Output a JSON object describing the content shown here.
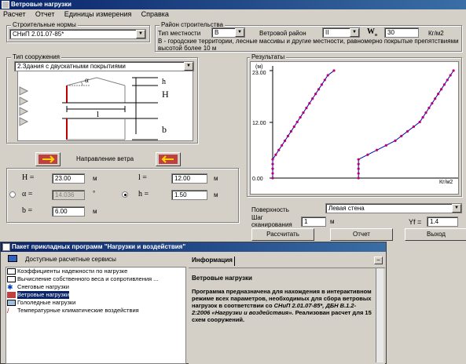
{
  "window1": {
    "title": "Ветровые нагрузки",
    "menu": [
      "Расчет",
      "Отчет",
      "Единицы измерения",
      "Справка"
    ],
    "norms": {
      "label": "Строительные нормы",
      "value": "СНиП 2.01.07-85*"
    },
    "region": {
      "label": "Район строительства",
      "terrain_label": "Тип местности",
      "terrain_value": "В",
      "wind_label": "Ветровой район",
      "wind_value": "II",
      "w0_label": "W",
      "w0_sub": "o",
      "w0_value": "30",
      "w0_unit": "Кг/м2",
      "description": "В - городские территории, лесные массивы и другие местности, равномерно покрытые препятствиями высотой более 10 м"
    },
    "structure": {
      "label": "Тип сооружения",
      "value": "2.Здания с двускатными покрытиями"
    },
    "diagram": {
      "alpha": "α",
      "h": "h",
      "H": "H",
      "l": "l",
      "b": "b"
    },
    "wind_dir_label": "Направление ветра",
    "params": {
      "H_label": "H =",
      "H_value": "23.00",
      "H_unit": "м",
      "l_label": "l =",
      "l_value": "12.00",
      "l_unit": "м",
      "alpha_label": "α =",
      "alpha_value": "14.036",
      "alpha_unit": "°",
      "h_label": "h =",
      "h_value": "1.50",
      "h_unit": "м",
      "b_label": "b =",
      "b_value": "6.00",
      "b_unit": "м"
    },
    "results": {
      "label": "Результаты",
      "y_unit": "(м)",
      "y_ticks": [
        "23.00",
        "12.00",
        "0.00"
      ],
      "x_unit": "Кг/м2"
    },
    "surface": {
      "label": "Поверхность",
      "value": "Левая стена"
    },
    "step": {
      "label1": "Шаг",
      "label2": "сканирования",
      "value": "1",
      "unit": "м"
    },
    "gamma": {
      "label": "Yf =",
      "value": "1.4"
    },
    "buttons": {
      "calc": "Рассчитать",
      "report": "Отчет",
      "exit": "Выход"
    }
  },
  "window2": {
    "title": "Пакет прикладных программ \"Нагрузки и воздействия\"",
    "services_label": "Доступные расчетные сервисы",
    "items": [
      "Коэффициенты надежности по нагрузке",
      "Вычисление собственного веса и сопротивления ...",
      "Снеговые нагрузки",
      "Ветровые нагрузки",
      "Гололедные нагрузки",
      "Температурные климатические воздействия"
    ],
    "info_tab": "Информация",
    "info_title": "Ветровые нагрузки",
    "info_text_1": "Программа предназначена для нахождения в интерактивном режиме всех параметров, необходимых для сбора ветровых нагрузок в соответствии со ",
    "info_text_italic": "СНиП 2.01.07-85*, ДБН В.1.2-2:2006 «Нагрузки и воздействия».",
    "info_text_2": " Реализован расчет для 15 схем сооружений."
  },
  "chart_data": {
    "type": "line",
    "title": "",
    "xlabel": "Кг/м2",
    "ylabel": "(м)",
    "ylim": [
      0,
      23
    ],
    "y_ticks": [
      0,
      12,
      23
    ],
    "series": [
      {
        "points": [
          [
            0,
            0
          ],
          [
            0,
            1
          ],
          [
            0,
            2
          ],
          [
            0,
            3
          ],
          [
            0,
            4
          ],
          [
            1,
            5
          ],
          [
            2,
            6
          ],
          [
            3,
            7
          ],
          [
            4,
            8
          ],
          [
            5,
            9
          ],
          [
            6,
            10
          ],
          [
            7,
            11
          ],
          [
            8,
            12
          ],
          [
            9,
            13
          ],
          [
            10,
            14
          ],
          [
            11,
            15
          ],
          [
            12,
            16
          ],
          [
            13,
            17
          ],
          [
            14,
            18
          ],
          [
            15,
            19
          ],
          [
            16,
            20
          ],
          [
            17,
            21
          ],
          [
            18,
            22
          ],
          [
            20,
            23
          ]
        ]
      },
      {
        "points": [
          [
            28,
            0
          ],
          [
            28,
            1
          ],
          [
            28,
            2
          ],
          [
            28,
            3
          ],
          [
            28,
            4
          ],
          [
            31,
            5
          ],
          [
            34,
            6
          ],
          [
            37,
            7
          ],
          [
            40,
            8
          ],
          [
            42,
            9
          ],
          [
            44,
            10
          ],
          [
            46,
            11
          ],
          [
            48,
            12
          ],
          [
            49,
            13
          ],
          [
            50,
            14
          ],
          [
            51,
            15
          ],
          [
            52,
            16
          ],
          [
            53,
            17
          ],
          [
            54,
            18
          ],
          [
            55,
            19
          ],
          [
            56,
            20
          ],
          [
            57,
            21
          ],
          [
            58,
            22
          ],
          [
            59,
            23
          ]
        ]
      }
    ]
  }
}
